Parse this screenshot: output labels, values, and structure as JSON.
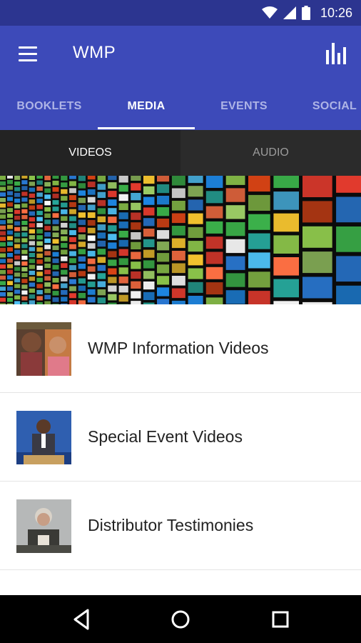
{
  "status": {
    "time": "10:26"
  },
  "app": {
    "title": "WMP"
  },
  "tabs": [
    {
      "label": "BOOKLETS",
      "active": false
    },
    {
      "label": "MEDIA",
      "active": true
    },
    {
      "label": "EVENTS",
      "active": false
    },
    {
      "label": "SOCIAL",
      "active": false
    }
  ],
  "subtabs": [
    {
      "label": "VIDEOS",
      "active": true
    },
    {
      "label": "AUDIO",
      "active": false
    }
  ],
  "list": [
    {
      "label": "WMP Information Videos"
    },
    {
      "label": "Special Event Videos"
    },
    {
      "label": "Distributor Testimonies"
    }
  ],
  "colors": {
    "primary": "#3d4ab9",
    "status_bar": "#2c3590",
    "subtab_bg": "#2b2b2b"
  }
}
